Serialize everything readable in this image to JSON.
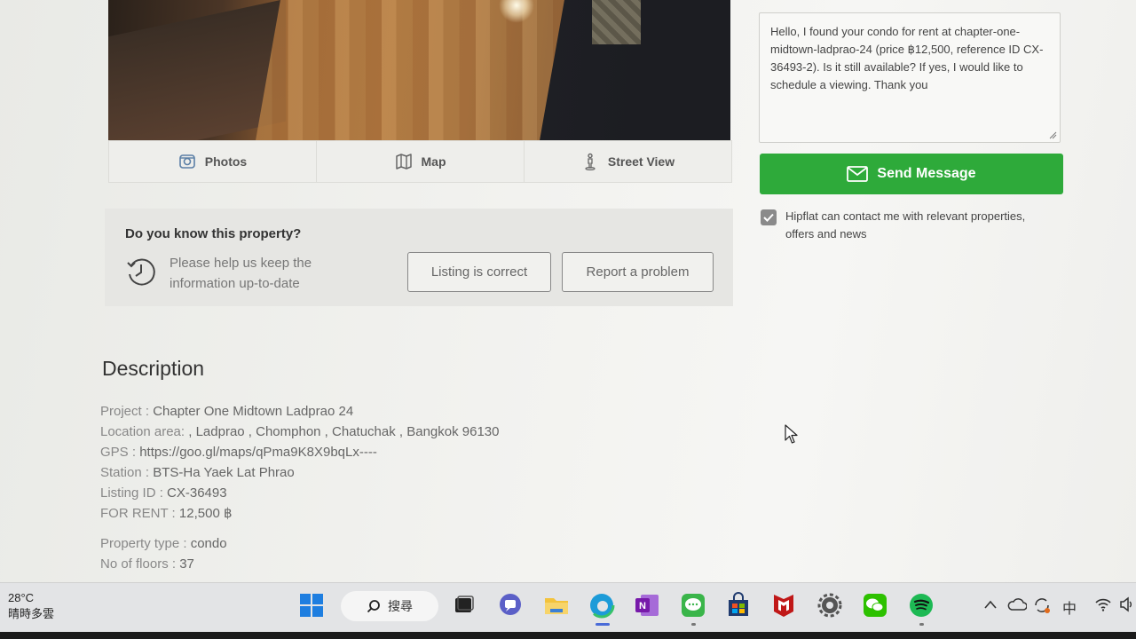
{
  "media_tabs": [
    {
      "label": "Photos",
      "icon": "camera-icon"
    },
    {
      "label": "Map",
      "icon": "map-icon"
    },
    {
      "label": "Street View",
      "icon": "street-view-icon"
    }
  ],
  "know_property": {
    "title": "Do you know this property?",
    "text": "Please help us keep the information up-to-date",
    "correct_label": "Listing is correct",
    "report_label": "Report a problem"
  },
  "description": {
    "title": "Description",
    "lines": [
      {
        "key": "Project : ",
        "value": "Chapter One Midtown Ladprao 24"
      },
      {
        "key": "Location area: ",
        "value": ", Ladprao , Chomphon , Chatuchak , Bangkok 96130"
      },
      {
        "key": "GPS : ",
        "value": "https://goo.gl/maps/qPma9K8X9bqLx----"
      },
      {
        "key": "Station : ",
        "value": "BTS-Ha Yaek Lat Phrao"
      },
      {
        "key": "Listing ID : ",
        "value": "CX-36493"
      },
      {
        "key": "FOR RENT : ",
        "value": "12,500 ฿"
      }
    ],
    "lines2": [
      {
        "key": "Property type : ",
        "value": "condo"
      },
      {
        "key": "No of floors : ",
        "value": "37"
      }
    ]
  },
  "contact": {
    "message": "Hello, I found your condo for rent at chapter-one-midtown-ladprao-24 (price ฿12,500, reference ID CX-36493-2). Is it still available? If yes, I would like to schedule a viewing. Thank you",
    "send_label": "Send Message",
    "consent_label": "Hipflat can contact me with relevant properties, offers and news",
    "consent_checked": true
  },
  "colors": {
    "send_button": "#2eaa3a"
  },
  "taskbar": {
    "temperature": "28°C",
    "weather": "晴時多雲",
    "search_label": "搜尋",
    "ime": "中"
  }
}
